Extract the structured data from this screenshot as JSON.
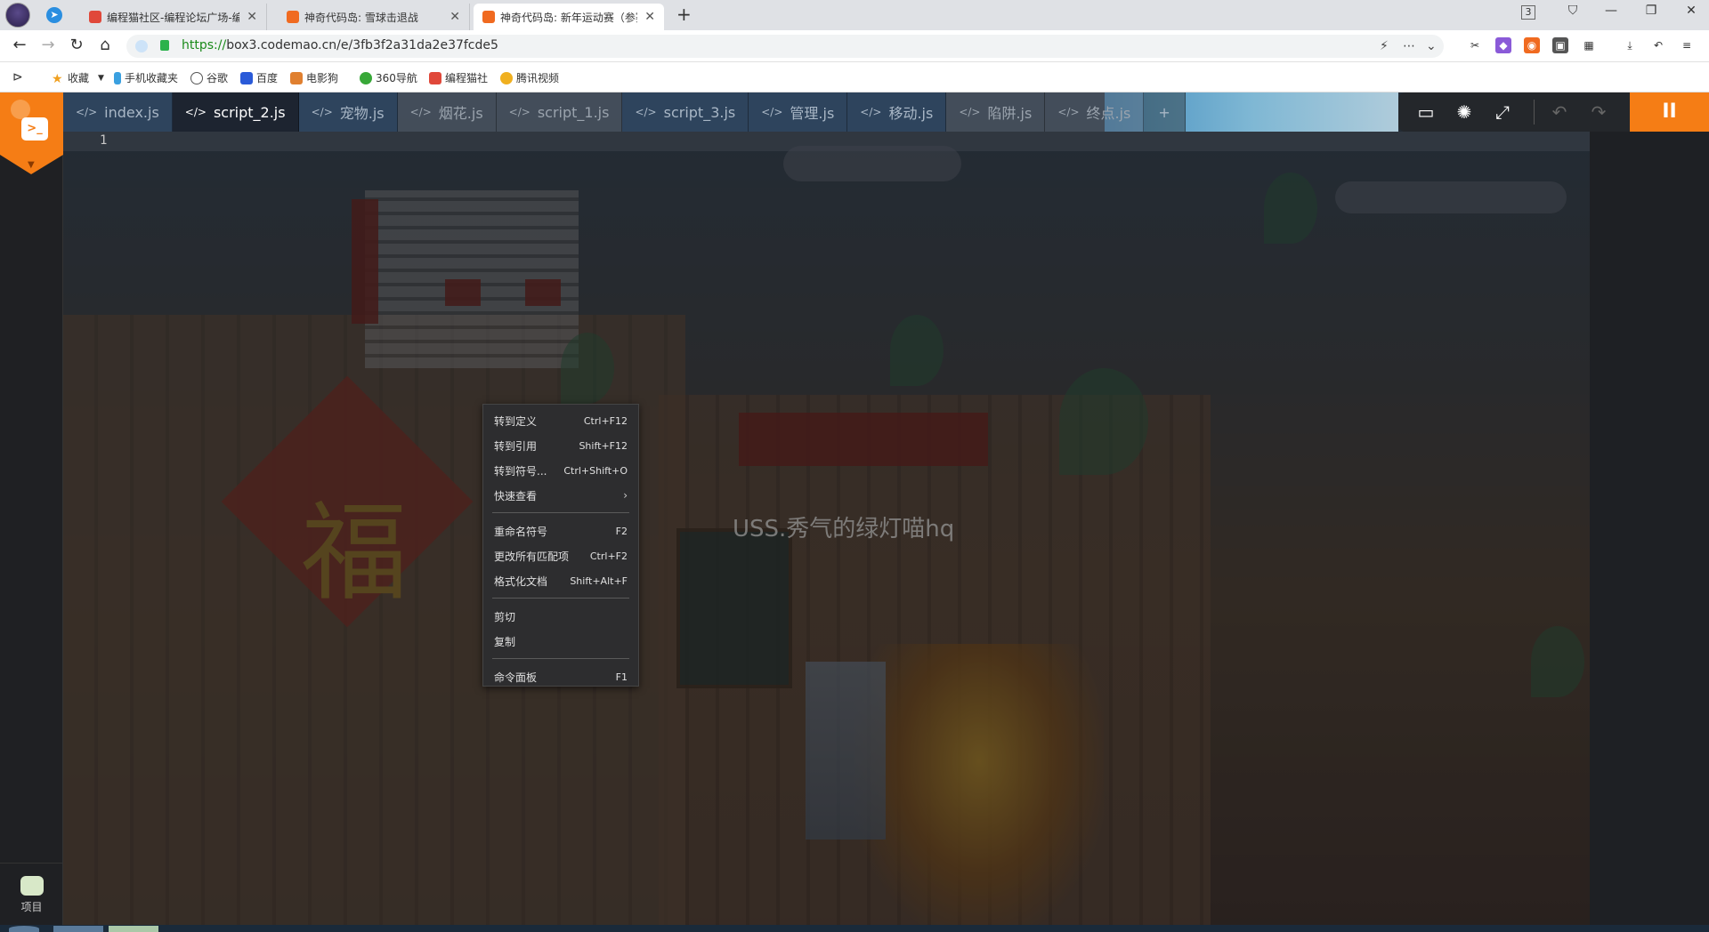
{
  "browser": {
    "tabs": [
      {
        "title": "编程猫社区-编程论坛广场-编程",
        "active": false
      },
      {
        "title": "神奇代码岛: 雪球击退战",
        "active": false
      },
      {
        "title": "神奇代码岛: 新年运动赛（参赛",
        "active": true
      }
    ],
    "tab_close_glyph": "✕",
    "tab_count_badge": "3",
    "url_scheme": "https://",
    "url_rest": "box3.codemao.cn/e/3fb3f2a31da2e37fcde5",
    "bookmarks": [
      "收藏",
      "手机收藏夹",
      "谷歌",
      "百度",
      "电影狗",
      "360导航",
      "编程猫社",
      "腾讯视频"
    ]
  },
  "editor": {
    "code_tabs": [
      {
        "label": "index.js",
        "state": "normal"
      },
      {
        "label": "script_2.js",
        "state": "active"
      },
      {
        "label": "宠物.js",
        "state": "normal"
      },
      {
        "label": "烟花.js",
        "state": "dimmed"
      },
      {
        "label": "script_1.js",
        "state": "dimmed"
      },
      {
        "label": "script_3.js",
        "state": "normal"
      },
      {
        "label": "管理.js",
        "state": "normal"
      },
      {
        "label": "移动.js",
        "state": "normal"
      },
      {
        "label": "陷阱.js",
        "state": "dimmed"
      },
      {
        "label": "终点.js",
        "state": "dimmed"
      }
    ],
    "add_tab_label": "+",
    "code_icon": "</>",
    "line_number": "1",
    "project_label": "项目",
    "watermark": "USS.秀气的绿灯喵hq",
    "fu_character": "福",
    "accent_color": "#f57d15"
  },
  "context_menu": {
    "items": [
      {
        "label": "转到定义",
        "shortcut": "Ctrl+F12"
      },
      {
        "label": "转到引用",
        "shortcut": "Shift+F12"
      },
      {
        "label": "转到符号...",
        "shortcut": "Ctrl+Shift+O"
      },
      {
        "label": "快速查看",
        "shortcut": "",
        "submenu": true
      },
      {
        "label": "重命名符号",
        "shortcut": "F2"
      },
      {
        "label": "更改所有匹配项",
        "shortcut": "Ctrl+F2"
      },
      {
        "label": "格式化文档",
        "shortcut": "Shift+Alt+F"
      },
      {
        "label": "剪切",
        "shortcut": ""
      },
      {
        "label": "复制",
        "shortcut": ""
      },
      {
        "label": "命令面板",
        "shortcut": "F1"
      }
    ]
  }
}
